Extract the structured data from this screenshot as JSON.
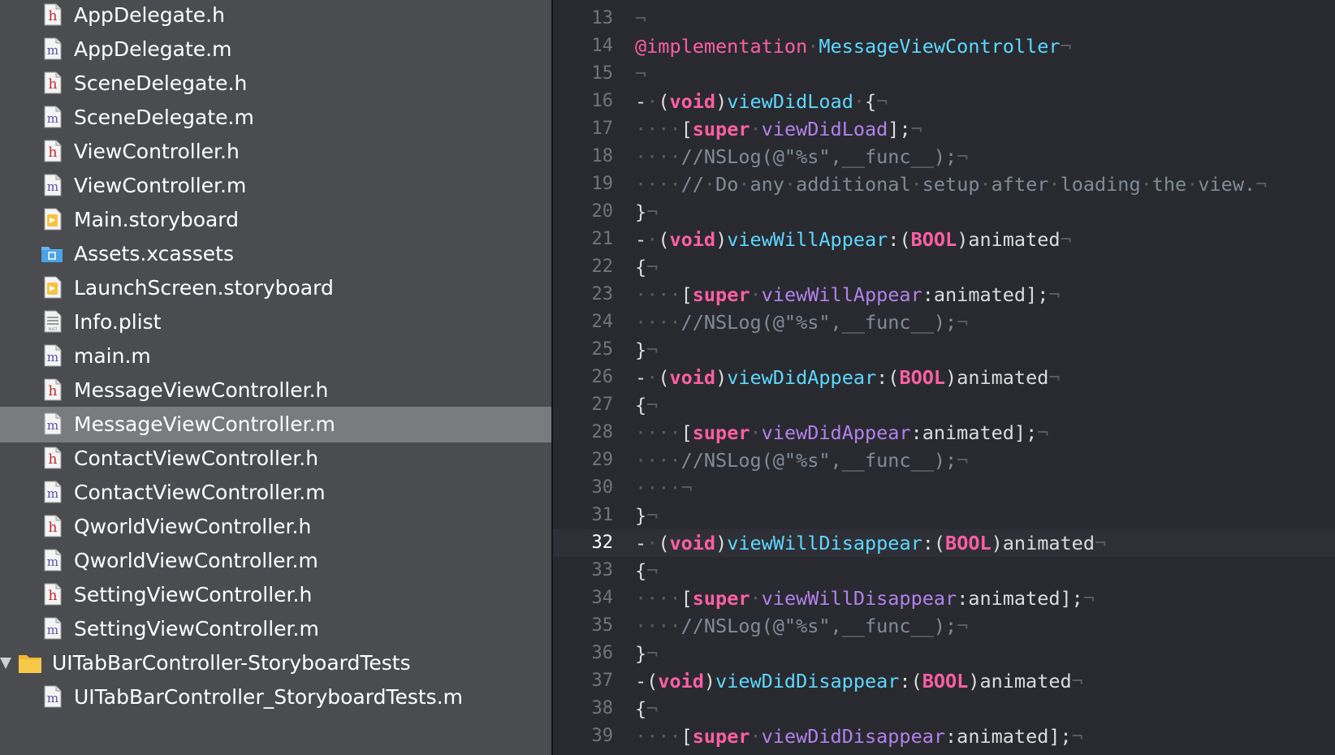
{
  "colors": {
    "navigator_bg": "#4b4c4f",
    "selection_bg": "#7a7b7e",
    "editor_bg": "#292a30",
    "current_line_bg": "#2f3037",
    "keyword": "#fc5fa3",
    "method_decl": "#5dd8ff",
    "method_call": "#b281eb",
    "comment": "#7f8c98",
    "plain": "#dcdcdd",
    "invisible": "#5a5b61",
    "line_number": "#747478"
  },
  "navigator": {
    "files": [
      {
        "name": "AppDelegate.h",
        "icon": "header-file-icon",
        "type": "h"
      },
      {
        "name": "AppDelegate.m",
        "icon": "source-file-icon",
        "type": "m"
      },
      {
        "name": "SceneDelegate.h",
        "icon": "header-file-icon",
        "type": "h"
      },
      {
        "name": "SceneDelegate.m",
        "icon": "source-file-icon",
        "type": "m"
      },
      {
        "name": "ViewController.h",
        "icon": "header-file-icon",
        "type": "h"
      },
      {
        "name": "ViewController.m",
        "icon": "source-file-icon",
        "type": "m"
      },
      {
        "name": "Main.storyboard",
        "icon": "storyboard-file-icon",
        "type": "storyboard"
      },
      {
        "name": "Assets.xcassets",
        "icon": "asset-catalog-icon",
        "type": "assets"
      },
      {
        "name": "LaunchScreen.storyboard",
        "icon": "storyboard-file-icon",
        "type": "storyboard"
      },
      {
        "name": "Info.plist",
        "icon": "plist-file-icon",
        "type": "plist"
      },
      {
        "name": "main.m",
        "icon": "source-file-icon",
        "type": "m"
      },
      {
        "name": "MessageViewController.h",
        "icon": "header-file-icon",
        "type": "h"
      },
      {
        "name": "MessageViewController.m",
        "icon": "source-file-icon",
        "type": "m",
        "selected": true
      },
      {
        "name": "ContactViewController.h",
        "icon": "header-file-icon",
        "type": "h"
      },
      {
        "name": "ContactViewController.m",
        "icon": "source-file-icon",
        "type": "m"
      },
      {
        "name": "QworldViewController.h",
        "icon": "header-file-icon",
        "type": "h"
      },
      {
        "name": "QworldViewController.m",
        "icon": "source-file-icon",
        "type": "m"
      },
      {
        "name": "SettingViewController.h",
        "icon": "header-file-icon",
        "type": "h"
      },
      {
        "name": "SettingViewController.m",
        "icon": "source-file-icon",
        "type": "m"
      },
      {
        "name": "UITabBarController-StoryboardTests",
        "icon": "folder-icon",
        "type": "folder",
        "expanded": true
      },
      {
        "name": "UITabBarController_StoryboardTests.m",
        "icon": "source-file-icon",
        "type": "m",
        "nested": true
      }
    ]
  },
  "editor": {
    "current_line": 32,
    "lines": [
      {
        "num": "13",
        "tokens": [
          [
            "inv",
            "¬"
          ]
        ]
      },
      {
        "num": "14",
        "tokens": [
          [
            "at",
            "@implementation"
          ],
          [
            "inv",
            "·"
          ],
          [
            "class",
            "MessageViewController"
          ],
          [
            "inv",
            "¬"
          ]
        ]
      },
      {
        "num": "15",
        "tokens": [
          [
            "inv",
            "¬"
          ]
        ]
      },
      {
        "num": "16",
        "tokens": [
          [
            "plain",
            "-"
          ],
          [
            "inv",
            "·"
          ],
          [
            "plain",
            "("
          ],
          [
            "kw",
            "void"
          ],
          [
            "plain",
            ")"
          ],
          [
            "method",
            "viewDidLoad"
          ],
          [
            "inv",
            "·"
          ],
          [
            "plain",
            "{"
          ],
          [
            "inv",
            "¬"
          ]
        ]
      },
      {
        "num": "17",
        "tokens": [
          [
            "inv",
            "····"
          ],
          [
            "plain",
            "["
          ],
          [
            "kw",
            "super"
          ],
          [
            "inv",
            "·"
          ],
          [
            "call",
            "viewDidLoad"
          ],
          [
            "plain",
            "];"
          ],
          [
            "inv",
            "¬"
          ]
        ]
      },
      {
        "num": "18",
        "tokens": [
          [
            "inv",
            "····"
          ],
          [
            "comment",
            "//NSLog(@\"%s\",__func__);"
          ],
          [
            "inv",
            "¬"
          ]
        ]
      },
      {
        "num": "19",
        "tokens": [
          [
            "inv",
            "····"
          ],
          [
            "comment",
            "//"
          ],
          [
            "inv",
            "·"
          ],
          [
            "comment",
            "Do"
          ],
          [
            "inv",
            "·"
          ],
          [
            "comment",
            "any"
          ],
          [
            "inv",
            "·"
          ],
          [
            "comment",
            "additional"
          ],
          [
            "inv",
            "·"
          ],
          [
            "comment",
            "setup"
          ],
          [
            "inv",
            "·"
          ],
          [
            "comment",
            "after"
          ],
          [
            "inv",
            "·"
          ],
          [
            "comment",
            "loading"
          ],
          [
            "inv",
            "·"
          ],
          [
            "comment",
            "the"
          ],
          [
            "inv",
            "·"
          ],
          [
            "comment",
            "view."
          ],
          [
            "inv",
            "¬"
          ]
        ]
      },
      {
        "num": "20",
        "tokens": [
          [
            "plain",
            "}"
          ],
          [
            "inv",
            "¬"
          ]
        ]
      },
      {
        "num": "21",
        "tokens": [
          [
            "plain",
            "-"
          ],
          [
            "inv",
            "·"
          ],
          [
            "plain",
            "("
          ],
          [
            "kw",
            "void"
          ],
          [
            "plain",
            ")"
          ],
          [
            "method",
            "viewWillAppear"
          ],
          [
            "plain",
            ":("
          ],
          [
            "kw",
            "BOOL"
          ],
          [
            "plain",
            ")animated"
          ],
          [
            "inv",
            "¬"
          ]
        ]
      },
      {
        "num": "22",
        "tokens": [
          [
            "plain",
            "{"
          ],
          [
            "inv",
            "¬"
          ]
        ]
      },
      {
        "num": "23",
        "tokens": [
          [
            "inv",
            "····"
          ],
          [
            "plain",
            "["
          ],
          [
            "kw",
            "super"
          ],
          [
            "inv",
            "·"
          ],
          [
            "call",
            "viewWillAppear"
          ],
          [
            "plain",
            ":animated];"
          ],
          [
            "inv",
            "¬"
          ]
        ]
      },
      {
        "num": "24",
        "tokens": [
          [
            "inv",
            "····"
          ],
          [
            "comment",
            "//NSLog(@\"%s\",__func__);"
          ],
          [
            "inv",
            "¬"
          ]
        ]
      },
      {
        "num": "25",
        "tokens": [
          [
            "plain",
            "}"
          ],
          [
            "inv",
            "¬"
          ]
        ]
      },
      {
        "num": "26",
        "tokens": [
          [
            "plain",
            "-"
          ],
          [
            "inv",
            "·"
          ],
          [
            "plain",
            "("
          ],
          [
            "kw",
            "void"
          ],
          [
            "plain",
            ")"
          ],
          [
            "method",
            "viewDidAppear"
          ],
          [
            "plain",
            ":("
          ],
          [
            "kw",
            "BOOL"
          ],
          [
            "plain",
            ")animated"
          ],
          [
            "inv",
            "¬"
          ]
        ]
      },
      {
        "num": "27",
        "tokens": [
          [
            "plain",
            "{"
          ],
          [
            "inv",
            "¬"
          ]
        ]
      },
      {
        "num": "28",
        "tokens": [
          [
            "inv",
            "····"
          ],
          [
            "plain",
            "["
          ],
          [
            "kw",
            "super"
          ],
          [
            "inv",
            "·"
          ],
          [
            "call",
            "viewDidAppear"
          ],
          [
            "plain",
            ":animated];"
          ],
          [
            "inv",
            "¬"
          ]
        ]
      },
      {
        "num": "29",
        "tokens": [
          [
            "inv",
            "····"
          ],
          [
            "comment",
            "//NSLog(@\"%s\",__func__);"
          ],
          [
            "inv",
            "¬"
          ]
        ]
      },
      {
        "num": "30",
        "tokens": [
          [
            "inv",
            "····¬"
          ]
        ]
      },
      {
        "num": "31",
        "tokens": [
          [
            "plain",
            "}"
          ],
          [
            "inv",
            "¬"
          ]
        ]
      },
      {
        "num": "32",
        "tokens": [
          [
            "plain",
            "-"
          ],
          [
            "inv",
            "·"
          ],
          [
            "plain",
            "("
          ],
          [
            "kw",
            "void"
          ],
          [
            "plain",
            ")"
          ],
          [
            "method",
            "viewWillDisappear"
          ],
          [
            "plain",
            ":("
          ],
          [
            "kw",
            "BOOL"
          ],
          [
            "plain",
            ")animated"
          ],
          [
            "inv",
            "¬"
          ]
        ]
      },
      {
        "num": "33",
        "tokens": [
          [
            "plain",
            "{"
          ],
          [
            "inv",
            "¬"
          ]
        ]
      },
      {
        "num": "34",
        "tokens": [
          [
            "inv",
            "····"
          ],
          [
            "plain",
            "["
          ],
          [
            "kw",
            "super"
          ],
          [
            "inv",
            "·"
          ],
          [
            "call",
            "viewWillDisappear"
          ],
          [
            "plain",
            ":animated];"
          ],
          [
            "inv",
            "¬"
          ]
        ]
      },
      {
        "num": "35",
        "tokens": [
          [
            "inv",
            "····"
          ],
          [
            "comment",
            "//NSLog(@\"%s\",__func__);"
          ],
          [
            "inv",
            "¬"
          ]
        ]
      },
      {
        "num": "36",
        "tokens": [
          [
            "plain",
            "}"
          ],
          [
            "inv",
            "¬"
          ]
        ]
      },
      {
        "num": "37",
        "tokens": [
          [
            "plain",
            "-("
          ],
          [
            "kw",
            "void"
          ],
          [
            "plain",
            ")"
          ],
          [
            "method",
            "viewDidDisappear"
          ],
          [
            "plain",
            ":("
          ],
          [
            "kw",
            "BOOL"
          ],
          [
            "plain",
            ")animated"
          ],
          [
            "inv",
            "¬"
          ]
        ]
      },
      {
        "num": "38",
        "tokens": [
          [
            "plain",
            "{"
          ],
          [
            "inv",
            "¬"
          ]
        ]
      },
      {
        "num": "39",
        "tokens": [
          [
            "inv",
            "····"
          ],
          [
            "plain",
            "["
          ],
          [
            "kw",
            "super"
          ],
          [
            "inv",
            "·"
          ],
          [
            "call",
            "viewDidDisappear"
          ],
          [
            "plain",
            ":animated];"
          ],
          [
            "inv",
            "¬"
          ]
        ]
      }
    ]
  }
}
